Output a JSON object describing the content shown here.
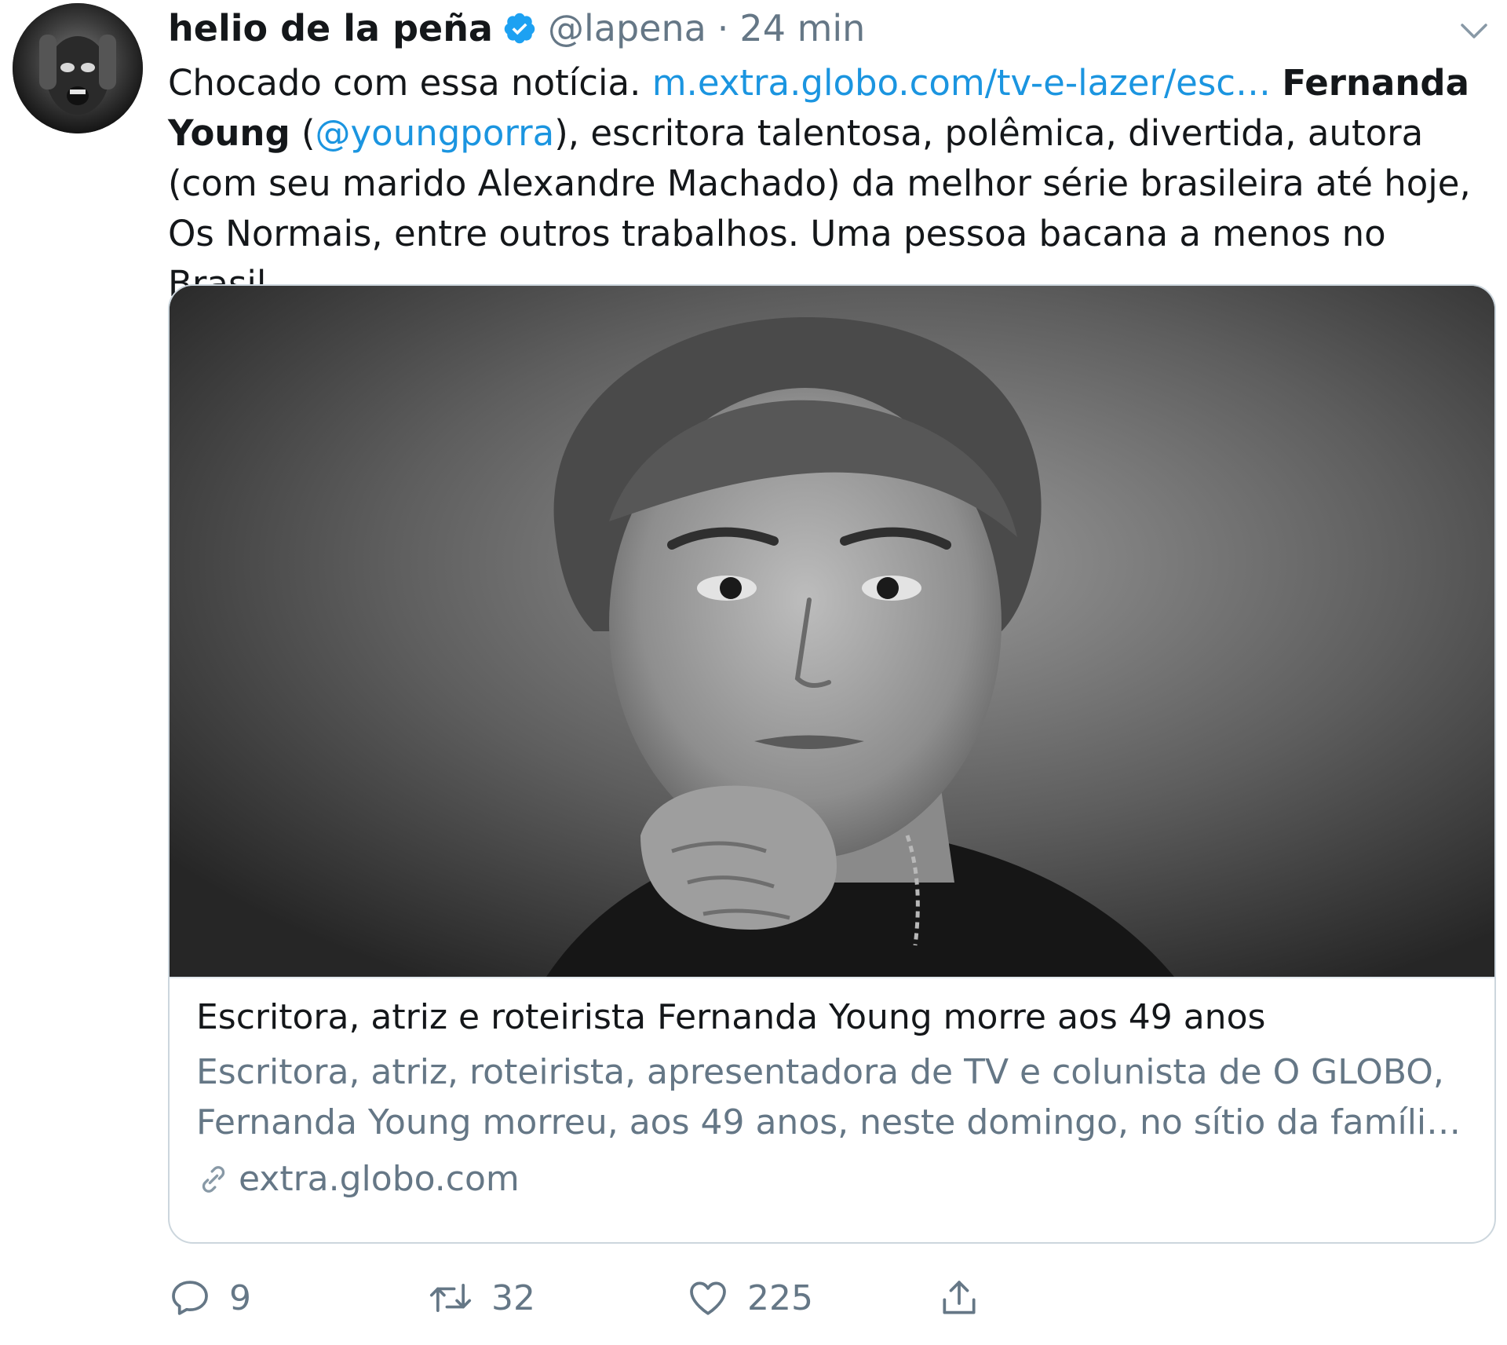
{
  "tweet": {
    "author": {
      "display_name": "helio de la peña",
      "handle": "@lapena",
      "verified": true
    },
    "separator": "·",
    "timestamp": "24 min",
    "text": {
      "part1": "Chocado com essa notícia. ",
      "link": "m.extra.globo.com/tv-e-lazer/esc…",
      "space": " ",
      "bold_name": "Fernanda Young",
      "paren_open": " (",
      "mention": "@youngporra",
      "part2": "), escritora talentosa, polêmica, divertida, autora (com seu marido Alexandre Machado) da melhor série brasileira até hoje, Os Normais, entre outros trabalhos. Uma pessoa bacana a menos no Brasil."
    },
    "card": {
      "title": "Escritora, atriz e roteirista Fernanda Young morre aos 49 anos",
      "description": "Escritora, atriz, roteirista, apresentadora de TV e colunista de O GLOBO, Fernanda Young morreu, aos 49 anos, neste domingo, no sítio da famíli…",
      "domain": "extra.globo.com",
      "domain_icon": "link-icon"
    },
    "actions": {
      "reply_count": "9",
      "retweet_count": "32",
      "like_count": "225"
    },
    "colors": {
      "link": "#1b95e0",
      "muted": "#657786",
      "text": "#14171a",
      "verified": "#1da1f2",
      "border": "#ccd6dd"
    }
  }
}
